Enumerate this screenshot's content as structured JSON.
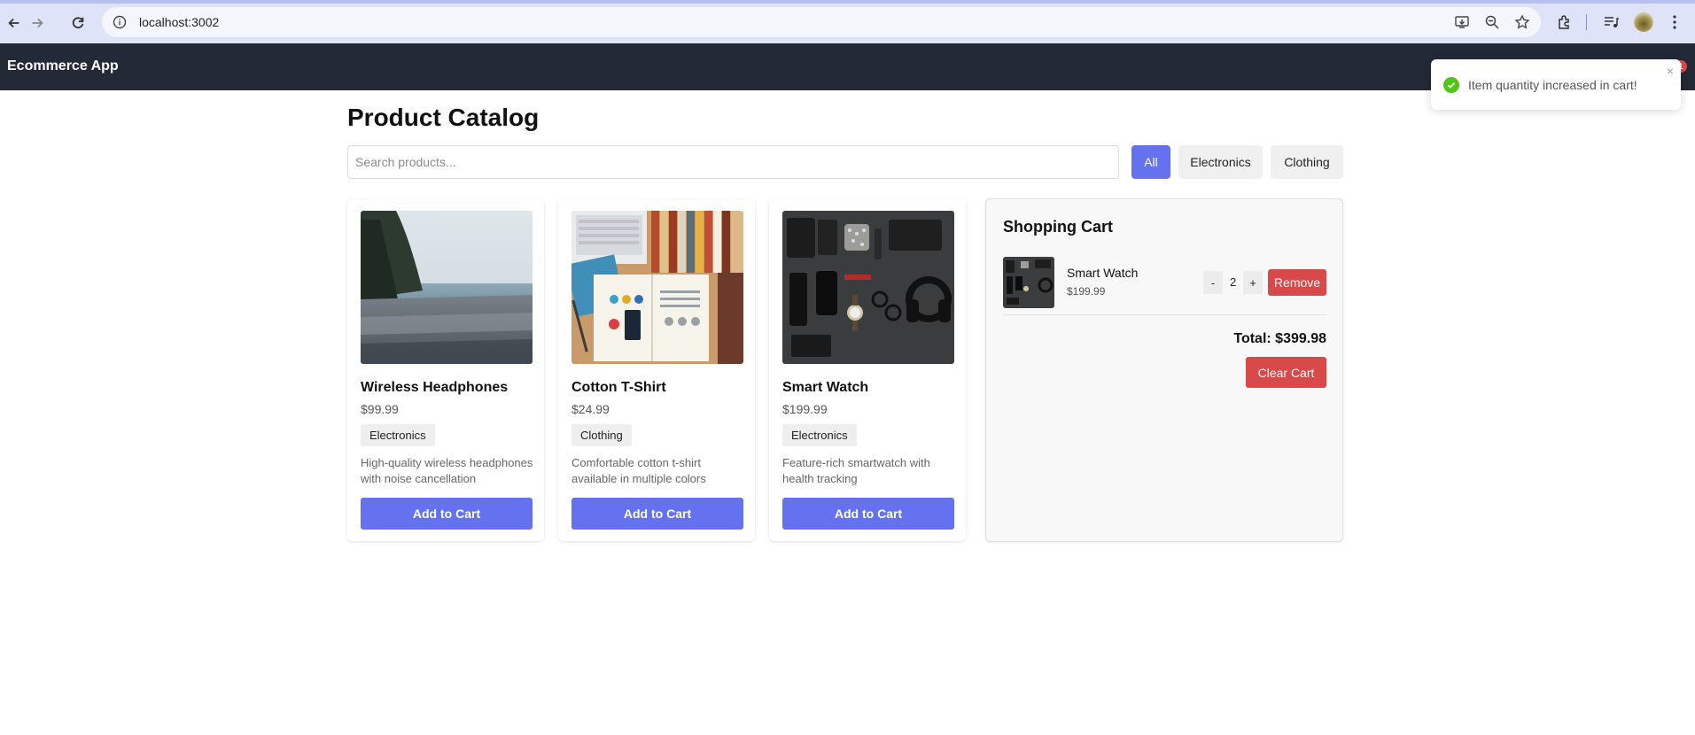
{
  "browser": {
    "url": "localhost:3002",
    "back_icon": "arrow-left-icon",
    "forward_icon": "arrow-right-icon",
    "reload_icon": "reload-icon"
  },
  "app": {
    "brand": "Ecommerce App",
    "cart_badge": "1"
  },
  "toast": {
    "message": "Item quantity increased in cart!",
    "close": "×"
  },
  "catalog": {
    "title": "Product Catalog",
    "search_placeholder": "Search products...",
    "filters": [
      "All",
      "Electronics",
      "Clothing"
    ],
    "active_filter": "All",
    "products": [
      {
        "name": "Wireless Headphones",
        "price": "$99.99",
        "category": "Electronics",
        "description": "High-quality wireless headphones with noise cancellation",
        "button": "Add to Cart"
      },
      {
        "name": "Cotton T-Shirt",
        "price": "$24.99",
        "category": "Clothing",
        "description": "Comfortable cotton t-shirt available in multiple colors",
        "button": "Add to Cart"
      },
      {
        "name": "Smart Watch",
        "price": "$199.99",
        "category": "Electronics",
        "description": "Feature-rich smartwatch with health tracking",
        "button": "Add to Cart"
      }
    ]
  },
  "cart": {
    "title": "Shopping Cart",
    "items": [
      {
        "name": "Smart Watch",
        "price": "$199.99",
        "quantity": "2",
        "decrement": "-",
        "increment": "+",
        "remove": "Remove"
      }
    ],
    "total": "Total: $399.98",
    "clear": "Clear Cart"
  },
  "colors": {
    "primary": "#6472ef",
    "danger": "#d84a4a",
    "navbar": "#232a36",
    "success": "#52c41a"
  }
}
